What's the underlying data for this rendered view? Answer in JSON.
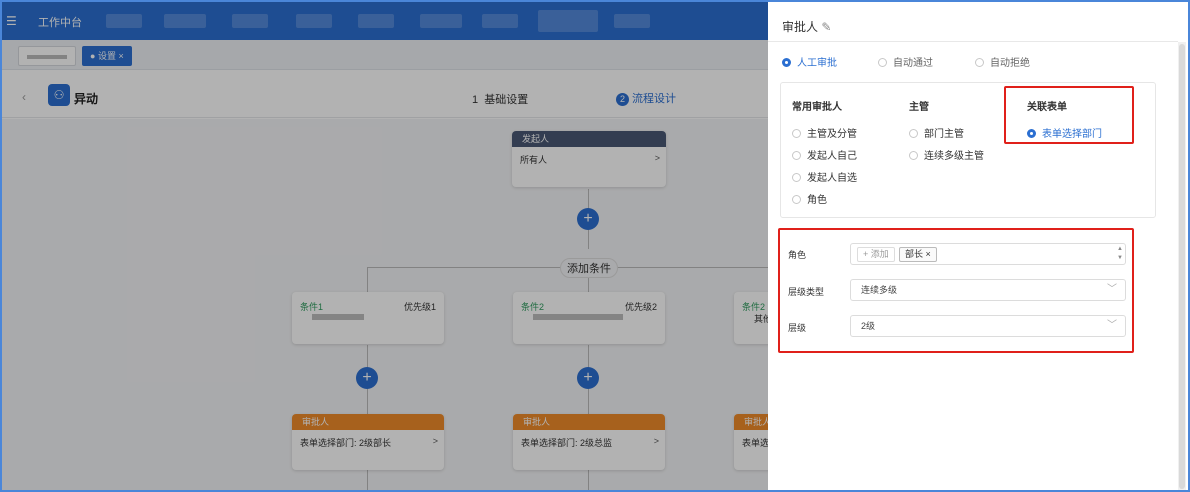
{
  "topbar": {
    "menu_icon": "menu-icon",
    "title": "工作中台"
  },
  "tabs": {
    "active": "设置",
    "close": "×"
  },
  "header": {
    "back_icon": "chevron-left-icon",
    "app_name": "异动",
    "step1_num": "1",
    "step1": "基础设置",
    "step2_num": "2",
    "step2": "流程设计"
  },
  "flow": {
    "start": {
      "head": "发起人",
      "body": "所有人"
    },
    "add_condition": "添加条件",
    "plus": "+",
    "chev": ">",
    "conditions": [
      {
        "title": "条件1",
        "priority": "优先级1"
      },
      {
        "title": "条件2",
        "priority": "优先级2"
      },
      {
        "title": "条件2",
        "priority": "其他"
      }
    ],
    "approvers": [
      {
        "head": "审批人",
        "body": "表单选择部门: 2级部长"
      },
      {
        "head": "审批人",
        "body": "表单选择部门: 2级总监"
      },
      {
        "head": "审批人",
        "body": "表单选"
      }
    ]
  },
  "panel": {
    "title": "审批人",
    "edit_icon": "pencil-icon",
    "modes": [
      "人工审批",
      "自动通过",
      "自动拒绝"
    ],
    "group_common": "常用审批人",
    "common": [
      "主管及分管",
      "发起人自己",
      "发起人自选",
      "角色"
    ],
    "group_manager": "主管",
    "manager": [
      "部门主管",
      "连续多级主管"
    ],
    "group_form": "关联表单",
    "form": [
      "表单选择部门"
    ],
    "role_label": "角色",
    "add_btn": "+ 添加",
    "role_tag": "部长 ×",
    "level_type_label": "层级类型",
    "level_type_value": "连续多级",
    "level_label": "层级",
    "level_value": "2级",
    "dropdown": "﹀"
  },
  "colors": {
    "brand": "#2b6fd1",
    "start": "#4a5875",
    "approver": "#f08c2a",
    "highlight": "#e0201a"
  }
}
